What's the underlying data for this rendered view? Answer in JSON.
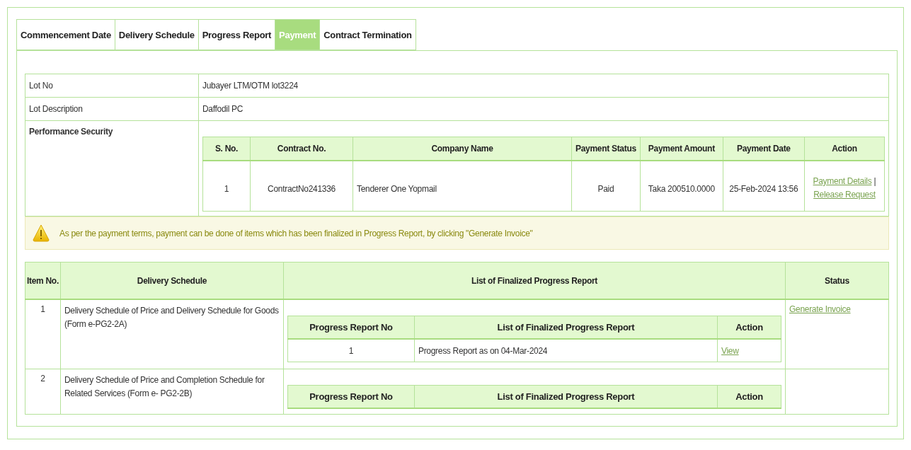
{
  "tabs": [
    {
      "label": "Commencement Date",
      "selected": false
    },
    {
      "label": "Delivery Schedule",
      "selected": false
    },
    {
      "label": "Progress Report",
      "selected": false
    },
    {
      "label": "Payment",
      "selected": true
    },
    {
      "label": "Contract Termination",
      "selected": false
    }
  ],
  "lot_info": [
    {
      "label": "Lot No",
      "value": "Jubayer LTM/OTM lot3224"
    },
    {
      "label": "Lot Description",
      "value": "Daffodil PC"
    }
  ],
  "performance_security": {
    "label": "Performance Security",
    "columns": [
      "S. No.",
      "Contract No.",
      "Company Name",
      "Payment Status",
      "Payment Amount",
      "Payment Date",
      "Action"
    ],
    "rows": [
      {
        "s_no": "1",
        "contract_no": "ContractNo241336",
        "company": "Tenderer One Yopmail",
        "status": "Paid",
        "amount": "Taka 200510.0000",
        "date": "25-Feb-2024 13:56",
        "actions": [
          "Payment Details",
          "Release Request"
        ],
        "separator": "|"
      }
    ]
  },
  "alert": "As per the payment terms, payment can be done of items which has been finalized in Progress Report, by clicking \"Generate Invoice\"",
  "delivery_table": {
    "columns": [
      "Item No.",
      "Delivery Schedule",
      "List of Finalized Progress Report",
      "Status"
    ],
    "items": [
      {
        "no": "1",
        "schedule": "Delivery Schedule of Price and Delivery Schedule for Goods (Form e-PG2-2A)",
        "report_columns": [
          "Progress Report No",
          "List of Finalized Progress Report",
          "Action"
        ],
        "reports": [
          {
            "no": "1",
            "title": "Progress Report as on 04-Mar-2024",
            "action": "View"
          }
        ],
        "status_link": "Generate Invoice"
      },
      {
        "no": "2",
        "schedule": "Delivery Schedule of Price and Completion Schedule for Related Services (Form e- PG2-2B)",
        "report_columns": [
          "Progress Report No",
          "List of Finalized Progress Report",
          "Action"
        ]
      }
    ]
  }
}
